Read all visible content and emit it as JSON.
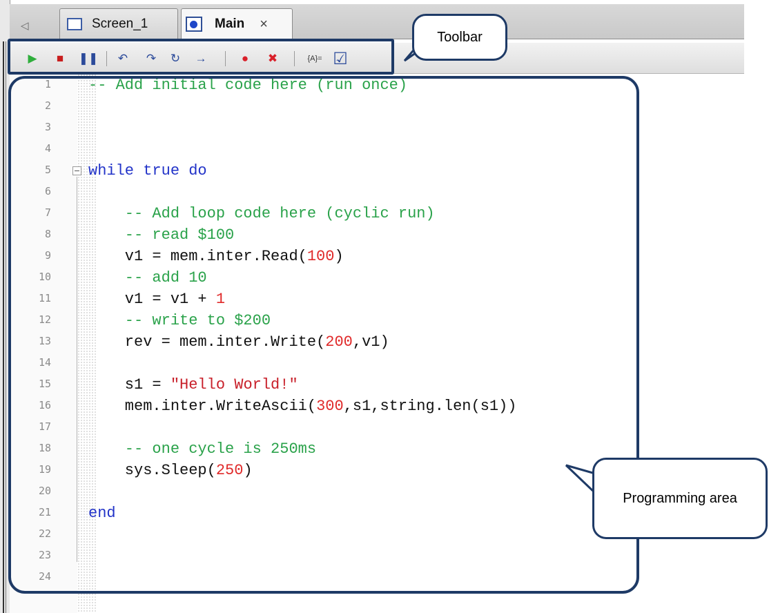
{
  "tabs": {
    "scroll_icon": "◁",
    "screen_tab_label": "Screen_1",
    "main_tab_label": "Main",
    "close_label": "×"
  },
  "toolbar": {
    "buttons": [
      {
        "name": "run-icon",
        "glyph": "▶",
        "color": "#2fae3c"
      },
      {
        "name": "stop-icon",
        "glyph": "■",
        "color": "#c81e1e"
      },
      {
        "name": "pause-icon",
        "glyph": "❚❚",
        "color": "#2b4a9a"
      },
      {
        "name": "step-into-icon",
        "glyph": "↶",
        "color": "#2b4a9a"
      },
      {
        "name": "step-over-icon",
        "glyph": "↷",
        "color": "#2b4a9a"
      },
      {
        "name": "step-out-icon",
        "glyph": "↻",
        "color": "#2b4a9a"
      },
      {
        "name": "run-to-cursor-icon",
        "glyph": "→",
        "color": "#2b4a9a"
      },
      {
        "name": "breakpoint-icon",
        "glyph": "●",
        "color": "#d9202a"
      },
      {
        "name": "clear-breakpoints-icon",
        "glyph": "✖",
        "color": "#d9202a"
      },
      {
        "name": "watch-variables-icon",
        "glyph": "{A}=",
        "color": "#333333"
      },
      {
        "name": "check-syntax-icon",
        "glyph": "☑",
        "color": "#2b4a9a"
      }
    ]
  },
  "editor": {
    "lines": [
      [
        {
          "t": "-- Add initial code here (run once)",
          "c": "c-comment"
        }
      ],
      [],
      [],
      [],
      [
        {
          "t": "while",
          "c": "c-kw"
        },
        {
          "t": " ",
          "c": "c-id"
        },
        {
          "t": "true",
          "c": "c-kw"
        },
        {
          "t": " ",
          "c": "c-id"
        },
        {
          "t": "do",
          "c": "c-kw"
        }
      ],
      [],
      [
        {
          "t": "    -- Add loop code here (cyclic run)",
          "c": "c-comment"
        }
      ],
      [
        {
          "t": "    -- read $100",
          "c": "c-comment"
        }
      ],
      [
        {
          "t": "    v1 = mem.inter.Read(",
          "c": "c-id"
        },
        {
          "t": "100",
          "c": "c-num"
        },
        {
          "t": ")",
          "c": "c-id"
        }
      ],
      [
        {
          "t": "    -- add 10",
          "c": "c-comment"
        }
      ],
      [
        {
          "t": "    v1 = v1 + ",
          "c": "c-id"
        },
        {
          "t": "1",
          "c": "c-num"
        }
      ],
      [
        {
          "t": "    -- write to $200",
          "c": "c-comment"
        }
      ],
      [
        {
          "t": "    rev = mem.inter.Write(",
          "c": "c-id"
        },
        {
          "t": "200",
          "c": "c-num"
        },
        {
          "t": ",v1)",
          "c": "c-id"
        }
      ],
      [],
      [
        {
          "t": "    s1 = ",
          "c": "c-id"
        },
        {
          "t": "\"Hello World!\"",
          "c": "c-str"
        }
      ],
      [
        {
          "t": "    mem.inter.WriteAscii(",
          "c": "c-id"
        },
        {
          "t": "300",
          "c": "c-num"
        },
        {
          "t": ",s1,string.len(s1))",
          "c": "c-id"
        }
      ],
      [],
      [
        {
          "t": "    -- one cycle is 250ms",
          "c": "c-comment"
        }
      ],
      [
        {
          "t": "    sys.Sleep(",
          "c": "c-id"
        },
        {
          "t": "250",
          "c": "c-num"
        },
        {
          "t": ")",
          "c": "c-id"
        }
      ],
      [],
      [
        {
          "t": "end",
          "c": "c-kw"
        }
      ],
      [],
      [],
      []
    ]
  },
  "annotations": {
    "toolbar_label": "Toolbar",
    "programming_area_label": "Programming area",
    "callout_color": "#1e3a66"
  }
}
